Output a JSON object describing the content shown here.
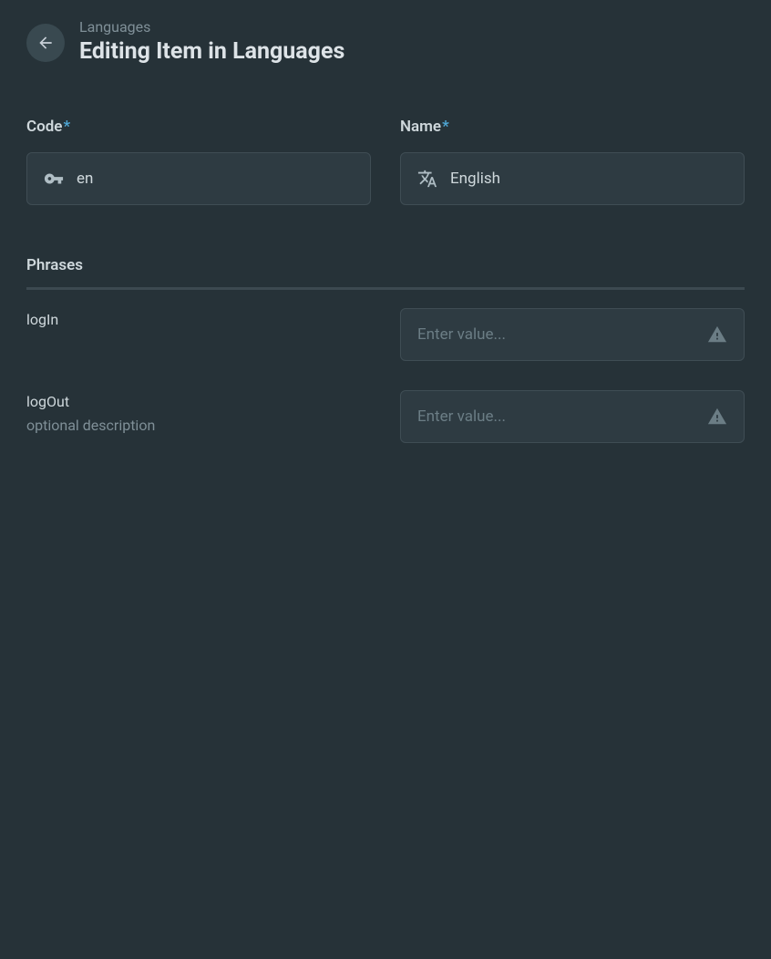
{
  "header": {
    "breadcrumb": "Languages",
    "title": "Editing Item in Languages"
  },
  "fields": {
    "code": {
      "label": "Code",
      "required": true,
      "value": "en"
    },
    "name": {
      "label": "Name",
      "required": true,
      "value": "English"
    }
  },
  "section": {
    "phrases_label": "Phrases"
  },
  "phrases": [
    {
      "key": "logIn",
      "description": "",
      "placeholder": "Enter value...",
      "value": ""
    },
    {
      "key": "logOut",
      "description": "optional description",
      "placeholder": "Enter value...",
      "value": ""
    }
  ]
}
